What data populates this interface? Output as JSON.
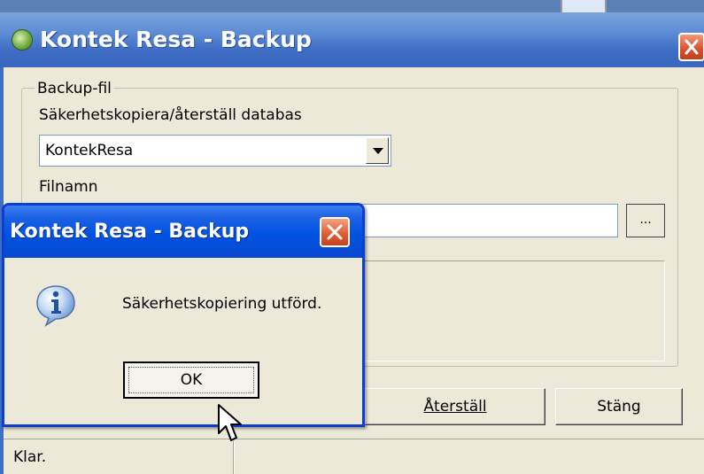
{
  "main_window": {
    "title": "Kontek Resa - Backup",
    "group_title": "Backup-fil",
    "database_label": "Säkerhetskopiera/återställ databas",
    "database_value": "KontekResa",
    "filename_label": "Filnamn",
    "filename_value": "",
    "browse_label": "...",
    "restore_label": "Återställ",
    "close_label": "Stäng",
    "status_text": "Klar."
  },
  "message_box": {
    "title": "Kontek Resa - Backup",
    "message": "Säkerhetskopiering utförd.",
    "ok_label": "OK",
    "icon": "info-icon"
  },
  "colors": {
    "title_bar_active": "#0053e1",
    "title_bar_inactive": "#5f8ed6",
    "close_button": "#d9502c",
    "window_face": "#ece9d8"
  }
}
